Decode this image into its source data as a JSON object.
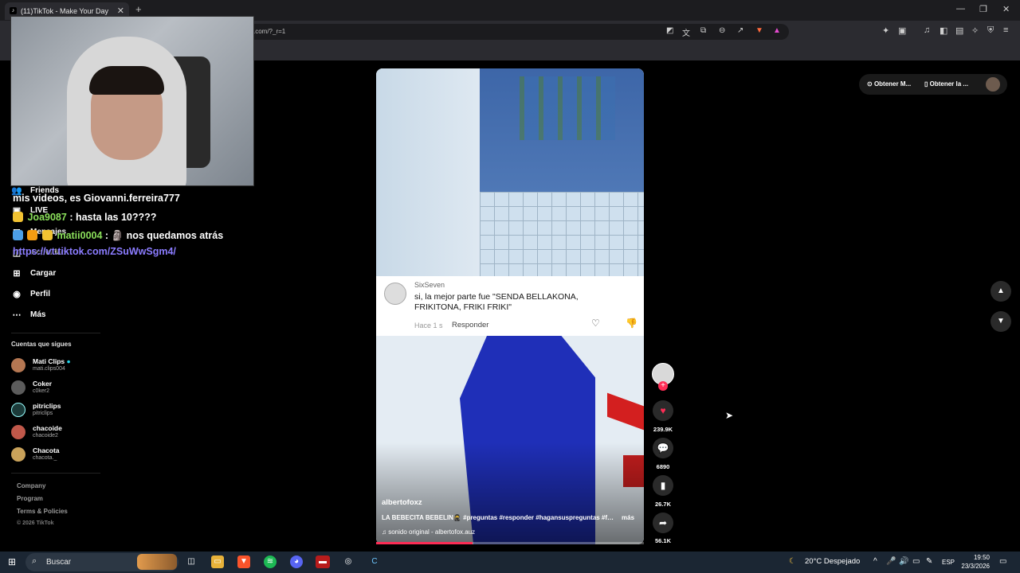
{
  "browser": {
    "tab_title": "(11)TikTok - Make Your Day",
    "tab_icon": "tiktok-icon",
    "new_tab": "+",
    "close": "✕",
    "url": ".com/?_r=1",
    "win_min": "—",
    "win_max": "❐",
    "win_close": "✕"
  },
  "sidebar": {
    "items": [
      {
        "label": "Friends",
        "icon": "friends-icon"
      },
      {
        "label": "LIVE",
        "icon": "live-icon"
      },
      {
        "label": "Mensajes",
        "icon": "messages-icon",
        "badge": "1"
      },
      {
        "label": "Actividad",
        "icon": "activity-icon"
      },
      {
        "label": "Cargar",
        "icon": "upload-icon"
      },
      {
        "label": "Perfil",
        "icon": "profile-icon"
      },
      {
        "label": "Más",
        "icon": "more-icon"
      }
    ],
    "following_title": "Cuentas que sigues",
    "following": [
      {
        "name": "Mati Clips",
        "handle": "mati.clips004",
        "verified": true
      },
      {
        "name": "Coker",
        "handle": "c0ker2"
      },
      {
        "name": "pitriclips",
        "handle": "pitriclips"
      },
      {
        "name": "chacoide",
        "handle": "chacoide2"
      },
      {
        "name": "Chacota",
        "handle": "chacota._"
      }
    ],
    "footer": [
      "Company",
      "Program",
      "Terms & Policies",
      "© 2026 TikTok"
    ]
  },
  "chat": [
    {
      "user": "",
      "text": "mis videos, es Giovanni.ferreira777"
    },
    {
      "user": "Joa9087",
      "text": ": hasta las 10????"
    },
    {
      "user": "matii0004",
      "text": ": 🗿 nos quedamos atrás"
    },
    {
      "user": "",
      "link": "https://vt.tiktok.com/ZSuWwSgm4/"
    }
  ],
  "comment": {
    "user": "SixSeven",
    "text": "si, la mejor parte fue \"SENDA BELLAKONA, FRIKITONA, FRIKI FRIKI\"",
    "time": "Hace 1 s",
    "reply": "Responder"
  },
  "video": {
    "author": "albertofoxz",
    "description": "LA BEBECITA BEBELIN🥷 #preguntas #responder #hagansuspreguntas #fyp #parati",
    "more": "más",
    "sound": "♫  sonido original - albertofox.auz",
    "progress": 0.36
  },
  "actions": {
    "likes": "239.9K",
    "comments": "6890",
    "saves": "26.7K",
    "shares": "56.1K"
  },
  "top_right": {
    "get_app": "Obtener M...",
    "get_app2": "Obtener la ..."
  },
  "taskbar": {
    "search": "Buscar",
    "weather": "20°C  Despejado",
    "lang": "ESP",
    "time": "19:50",
    "date": "23/3/2026"
  },
  "colors": {
    "accent": "#fe2c55",
    "background": "#000000",
    "chat_user": "#8be05b",
    "chat_link": "#8b7cff"
  }
}
